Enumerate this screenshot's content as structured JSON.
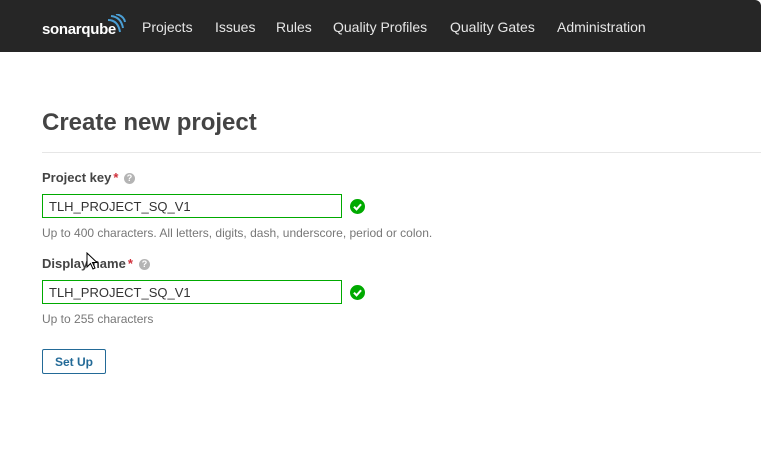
{
  "header": {
    "logo_text": "sonarqube",
    "nav": [
      {
        "label": "Projects"
      },
      {
        "label": "Issues"
      },
      {
        "label": "Rules"
      },
      {
        "label": "Quality Profiles"
      },
      {
        "label": "Quality Gates"
      },
      {
        "label": "Administration"
      }
    ]
  },
  "page": {
    "title": "Create new project"
  },
  "form": {
    "project_key": {
      "label": "Project key",
      "required_mark": "*",
      "value": "TLH_PROJECT_SQ_V1",
      "hint": "Up to 400 characters. All letters, digits, dash, underscore, period or colon."
    },
    "display_name": {
      "label": "Display name",
      "required_mark": "*",
      "value": "TLH_PROJECT_SQ_V1",
      "hint": "Up to 255 characters"
    },
    "submit_label": "Set Up"
  },
  "colors": {
    "topbar": "#262626",
    "valid": "#00aa00",
    "required": "#d02f3a",
    "button": "#236a97"
  }
}
